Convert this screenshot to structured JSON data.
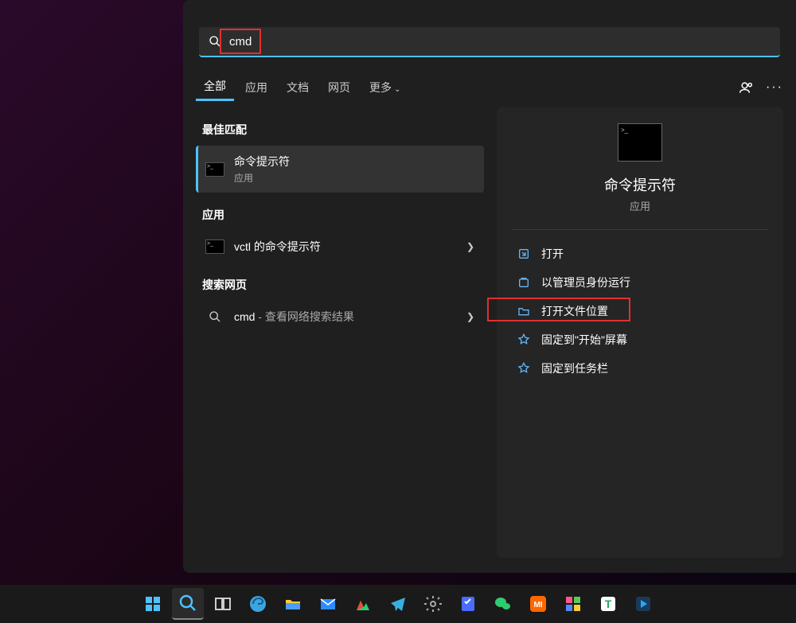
{
  "search": {
    "query": "cmd"
  },
  "tabs": {
    "items": [
      {
        "label": "全部",
        "active": true
      },
      {
        "label": "应用",
        "active": false
      },
      {
        "label": "文档",
        "active": false
      },
      {
        "label": "网页",
        "active": false
      },
      {
        "label": "更多",
        "active": false,
        "has_chevron": true
      }
    ]
  },
  "left": {
    "best_match_header": "最佳匹配",
    "best_match": {
      "title": "命令提示符",
      "subtitle": "应用"
    },
    "apps_header": "应用",
    "apps": [
      {
        "title": "vctl 的命令提示符"
      }
    ],
    "web_header": "搜索网页",
    "web": [
      {
        "title": "cmd",
        "suffix": " - 查看网络搜索结果"
      }
    ]
  },
  "detail": {
    "title": "命令提示符",
    "subtitle": "应用",
    "actions": [
      {
        "icon": "open",
        "label": "打开"
      },
      {
        "icon": "admin",
        "label": "以管理员身份运行"
      },
      {
        "icon": "folder",
        "label": "打开文件位置"
      },
      {
        "icon": "pin",
        "label": "固定到\"开始\"屏幕"
      },
      {
        "icon": "pin",
        "label": "固定到任务栏"
      }
    ]
  },
  "taskbar": {
    "items": [
      {
        "name": "start",
        "color": "#4cc2ff"
      },
      {
        "name": "search",
        "color": "#4cc2ff",
        "active": true
      },
      {
        "name": "task-view",
        "color": "#ccc"
      },
      {
        "name": "edge",
        "color": "#3ba5e0"
      },
      {
        "name": "explorer",
        "color": "#ffcc33"
      },
      {
        "name": "mail",
        "color": "#2c8cff"
      },
      {
        "name": "app-green-peak",
        "color": "#2ecc71"
      },
      {
        "name": "telegram",
        "color": "#37aee2"
      },
      {
        "name": "settings",
        "color": "#aaa"
      },
      {
        "name": "todo",
        "color": "#4a6cff"
      },
      {
        "name": "wechat",
        "color": "#2ecc71"
      },
      {
        "name": "xiaomi",
        "color": "#ff6700"
      },
      {
        "name": "store",
        "color": "#ff5588"
      },
      {
        "name": "text-app",
        "color": "#fff"
      },
      {
        "name": "blue-play",
        "color": "#22aaff"
      }
    ]
  }
}
